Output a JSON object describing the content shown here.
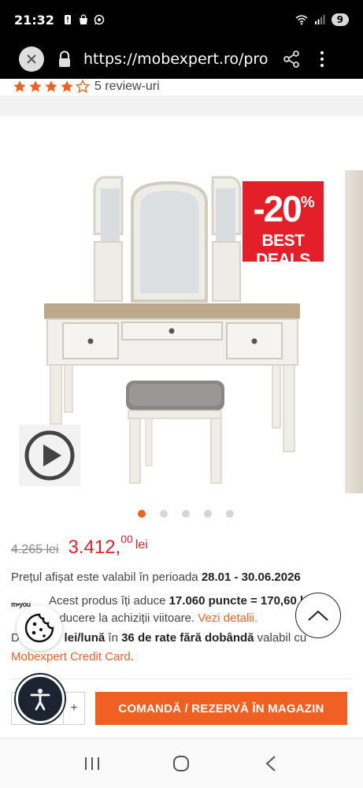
{
  "status_bar": {
    "time": "21:32",
    "battery": "9",
    "icons": [
      "alert-icon",
      "bag-icon",
      "whatsapp-icon",
      "wifi-icon",
      "signal-icon"
    ]
  },
  "browser": {
    "url": "https://mobexpert.ro/produse",
    "icons": [
      "close-icon",
      "lock-icon",
      "share-icon",
      "more-vert-icon"
    ]
  },
  "product": {
    "rating": 4,
    "reviews_label": "5 review-uri",
    "badge_percent": "-20",
    "badge_percent_sign": "%",
    "badge_label": "BEST DEALS",
    "gallery_count": 5,
    "gallery_active": 0,
    "old_price": "4.265 lei",
    "new_price_int": "3.412,",
    "new_price_dec": "00",
    "new_price_currency": "lei",
    "validity_prefix": "Prețul afișat este valabil în perioada ",
    "validity_dates": "28.01 - 30.06.2026",
    "myou_label": "m•you",
    "points_prefix": "Acest produs îți aduce ",
    "points_bold": "17.060 puncte = 170,60 lei",
    "points_suffix": " reducere la achiziții viitoare. ",
    "points_link": "Vezi detalii.",
    "inst_prefix": "De la ",
    "inst_amount": "117 lei/lună",
    "inst_mid": " în ",
    "inst_count": "36 de rate fără dobândă",
    "inst_suffix": " valabil cu ",
    "inst_card": "Mobexpert Credit Card",
    "inst_end": ".",
    "qty_plus": "+",
    "order_button": "COMANDĂ / REZERVĂ ÎN MAGAZIN"
  },
  "colors": {
    "accent": "#f06022",
    "price_red": "#e3202a",
    "star": "#f06022"
  }
}
